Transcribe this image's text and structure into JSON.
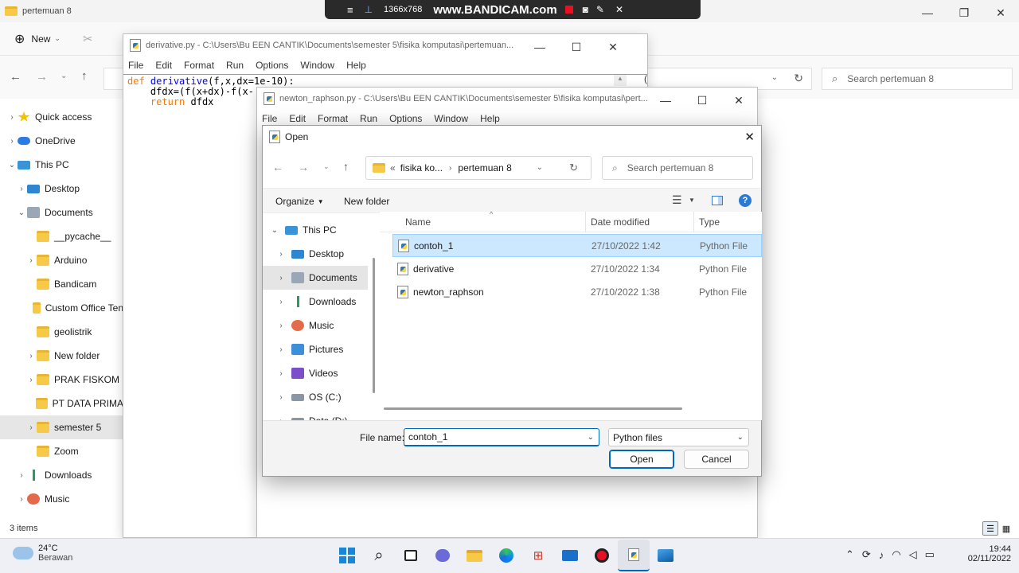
{
  "recorder": {
    "resolution": "1366x768",
    "brand": "www.BANDICAM.com"
  },
  "explorer": {
    "title": "pertemuan 8",
    "new_label": "New",
    "search_placeholder": "Search pertemuan 8",
    "status": "3 items",
    "nav": [
      {
        "label": "Quick access",
        "icon": "star-icon",
        "chev": "›"
      },
      {
        "label": "OneDrive",
        "icon": "cloud-icon",
        "chev": "›"
      },
      {
        "label": "This PC",
        "icon": "pc-icon",
        "chev": "⌄"
      },
      {
        "label": "Desktop",
        "icon": "desktop-icon",
        "chev": "›"
      },
      {
        "label": "Documents",
        "icon": "documents-icon",
        "chev": "⌄"
      },
      {
        "label": "__pycache__",
        "icon": "folder-icon",
        "chev": ""
      },
      {
        "label": "Arduino",
        "icon": "folder-icon",
        "chev": "›"
      },
      {
        "label": "Bandicam",
        "icon": "folder-icon",
        "chev": ""
      },
      {
        "label": "Custom Office Ten",
        "icon": "folder-icon",
        "chev": ""
      },
      {
        "label": "geolistrik",
        "icon": "folder-icon",
        "chev": ""
      },
      {
        "label": "New folder",
        "icon": "folder-icon",
        "chev": "›"
      },
      {
        "label": "PRAK FISKOM",
        "icon": "folder-icon",
        "chev": "›"
      },
      {
        "label": "PT DATA PRIMA",
        "icon": "folder-icon",
        "chev": ""
      },
      {
        "label": "semester 5",
        "icon": "folder-icon",
        "chev": "›"
      },
      {
        "label": "Zoom",
        "icon": "folder-icon",
        "chev": ""
      },
      {
        "label": "Downloads",
        "icon": "download-icon",
        "chev": "›"
      },
      {
        "label": "Music",
        "icon": "music-icon",
        "chev": "›"
      }
    ]
  },
  "idle1": {
    "title": "derivative.py - C:\\Users\\Bu EEN CANTIK\\Documents\\semester 5\\fisika komputasi\\pertemuan...",
    "menu": [
      "File",
      "Edit",
      "Format",
      "Run",
      "Options",
      "Window",
      "Help"
    ],
    "code": [
      "def derivative(f,x,dx=1e-10):",
      "    dfdx=(f(x+dx)-f(x-",
      "    return dfdx"
    ]
  },
  "idle2": {
    "title": "newton_raphson.py - C:\\Users\\Bu EEN CANTIK\\Documents\\semester 5\\fisika komputasi\\pert...",
    "menu": [
      "File",
      "Edit",
      "Format",
      "Run",
      "Options",
      "Window",
      "Help"
    ]
  },
  "dialog": {
    "title": "Open",
    "breadcrumb": {
      "prefix": "«",
      "parent": "fisika ko...",
      "current": "pertemuan 8"
    },
    "search_placeholder": "Search pertemuan 8",
    "organize": "Organize",
    "new_folder": "New folder",
    "tree": [
      {
        "label": "This PC",
        "icon": "pc-icon",
        "chev": "⌄"
      },
      {
        "label": "Desktop",
        "icon": "desktop-icon",
        "chev": "›"
      },
      {
        "label": "Documents",
        "icon": "documents-icon",
        "chev": "›"
      },
      {
        "label": "Downloads",
        "icon": "download-icon",
        "chev": "›"
      },
      {
        "label": "Music",
        "icon": "music-icon",
        "chev": "›"
      },
      {
        "label": "Pictures",
        "icon": "pictures-icon",
        "chev": "›"
      },
      {
        "label": "Videos",
        "icon": "videos-icon",
        "chev": "›"
      },
      {
        "label": "OS (C:)",
        "icon": "drive-icon",
        "chev": "›"
      },
      {
        "label": "Data (D:)",
        "icon": "drive-icon",
        "chev": "›"
      }
    ],
    "columns": {
      "name": "Name",
      "date": "Date modified",
      "type": "Type"
    },
    "files": [
      {
        "name": "contoh_1",
        "date": "27/10/2022 1:42",
        "type": "Python File"
      },
      {
        "name": "derivative",
        "date": "27/10/2022 1:34",
        "type": "Python File"
      },
      {
        "name": "newton_raphson",
        "date": "27/10/2022 1:38",
        "type": "Python File"
      }
    ],
    "filename_label": "File name:",
    "filename_value": "contoh_1",
    "filetype": "Python files",
    "open": "Open",
    "cancel": "Cancel"
  },
  "taskbar": {
    "weather_temp": "24°C",
    "weather_desc": "Berawan",
    "time": "19:44",
    "date": "02/11/2022"
  },
  "colors": {
    "selection": "#cce8ff",
    "accent": "#0067c0",
    "recording": "#e81123"
  }
}
